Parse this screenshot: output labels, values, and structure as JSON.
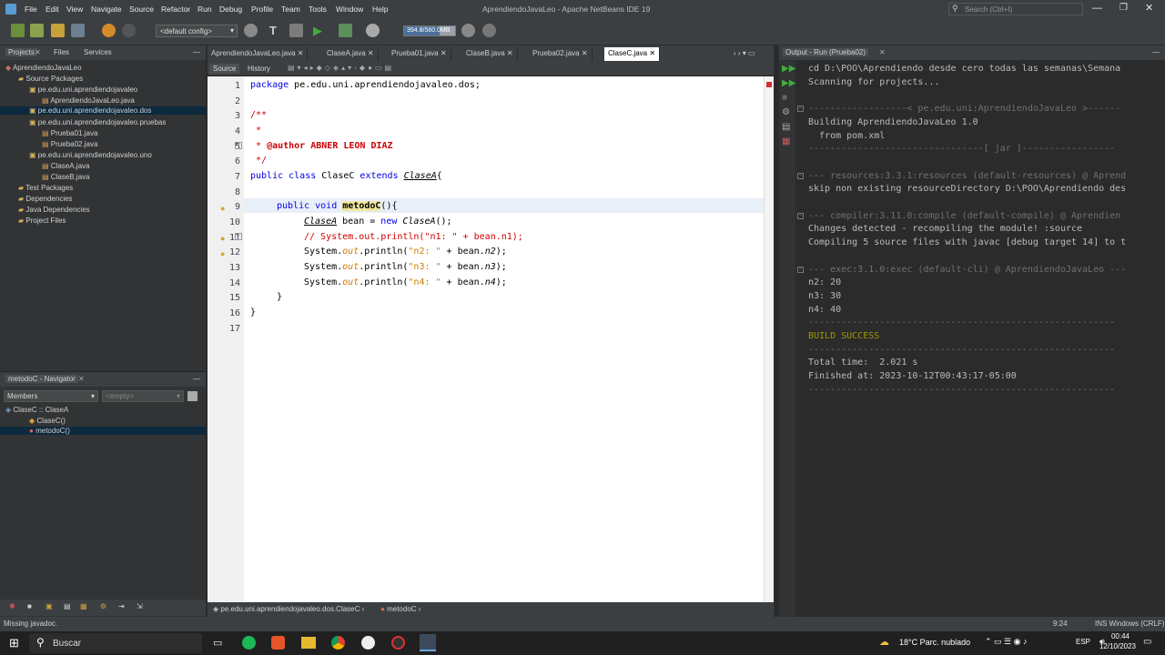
{
  "window": {
    "title": "AprendiendoJavaLeo - Apache NetBeans IDE 19",
    "search_placeholder": "Search (Ctrl+I)"
  },
  "menu": [
    "File",
    "Edit",
    "View",
    "Navigate",
    "Source",
    "Refactor",
    "Run",
    "Debug",
    "Profile",
    "Team",
    "Tools",
    "Window",
    "Help"
  ],
  "toolbar": {
    "config": "<default config>",
    "memory": "394.8/560.0MB"
  },
  "projects": {
    "tabs": [
      "Projects",
      "Files",
      "Services"
    ],
    "tree": [
      "AprendiendoJavaLeo",
      "Source Packages",
      "pe.edu.uni.aprendiendojavaleo",
      "AprendiendoJavaLeo.java",
      "pe.edu.uni.aprendiendojavaleo.dos",
      "pe.edu.uni.aprendiendojavaleo.pruebas",
      "Prueba01.java",
      "Prueba02.java",
      "pe.edu.uni.aprendiendojavaleo.uno",
      "ClaseA.java",
      "ClaseB.java",
      "Test Packages",
      "Dependencies",
      "Java Dependencies",
      "Project Files"
    ]
  },
  "navigator": {
    "title": "metodoC - Navigator",
    "filter": "Members",
    "empty": "<empty>",
    "items": [
      "ClaseC :: ClaseA",
      "ClaseC()",
      "metodoC()"
    ]
  },
  "editor": {
    "tabs": [
      "AprendiendoJavaLeo.java",
      "ClaseA.java",
      "Prueba01.java",
      "ClaseB.java",
      "Prueba02.java",
      "ClaseC.java"
    ],
    "source_tab": "Source",
    "history_tab": "History",
    "line_numbers": [
      "1",
      "2",
      "3",
      "4",
      "5",
      "6",
      "7",
      "8",
      "9",
      "10",
      "11",
      "12",
      "13",
      "14",
      "15",
      "16",
      "17"
    ],
    "code": {
      "l1a": "package",
      "l1b": " pe.edu.uni.aprendiendojavaleo.dos;",
      "l3": "/**",
      "l4": " *",
      "l5a": " * ",
      "l5b": "@author",
      "l5c": " ABNER LEON DIAZ",
      "l6": " */",
      "l7a": "public class",
      "l7b": " ClaseC ",
      "l7c": "extends",
      "l7d": "ClaseA",
      "l7e": "{",
      "l9a": "public void",
      "l9b": "metodoC",
      "l9c": "(){",
      "l10a": "ClaseA",
      "l10b": " bean = ",
      "l10c": "new",
      "l10d": "ClaseA",
      "l10e": "();",
      "l11": "// System.out.println(\"n1: \" + bean.n1);",
      "l12a": "System.",
      "l12b": "out",
      "l12c": ".println(",
      "l12d": "\"n2: \"",
      "l12e": " + bean.",
      "l12f": "n2",
      "l12g": ");",
      "l13a": "System.",
      "l13b": "out",
      "l13c": ".println(",
      "l13d": "\"n3: \"",
      "l13e": " + bean.",
      "l13f": "n3",
      "l13g": ");",
      "l14a": "System.",
      "l14b": "out",
      "l14c": ".println(",
      "l14d": "\"n4: \"",
      "l14e": " + bean.",
      "l14f": "n4",
      "l14g": ");",
      "l15": "}",
      "l16": "}"
    },
    "breadcrumb": [
      "pe.edu.uni.aprendiendojavaleo.dos.ClaseC",
      "metodoC"
    ]
  },
  "output": {
    "title": "Output - Run (Prueba02)",
    "lines": [
      "cd D:\\POO\\Aprendiendo desde cero todas las semanas\\Semana",
      "Scanning for projects...",
      "",
      "------------------< pe.edu.uni:AprendiendoJavaLeo >------",
      "Building AprendiendoJavaLeo 1.0",
      "  from pom.xml",
      "--------------------------------[ jar ]-----------------",
      "",
      "--- resources:3.3.1:resources (default-resources) @ Aprend",
      "skip non existing resourceDirectory D:\\POO\\Aprendiendo des",
      "",
      "--- compiler:3.11.0:compile (default-compile) @ Aprendien",
      "Changes detected - recompiling the module! :source",
      "Compiling 5 source files with javac [debug target 14] to t",
      "",
      "--- exec:3.1.0:exec (default-cli) @ AprendiendoJavaLeo ---",
      "n2: 20",
      "n3: 30",
      "n4: 40",
      "--------------------------------------------------------",
      "BUILD SUCCESS",
      "--------------------------------------------------------",
      "Total time:  2.021 s",
      "Finished at: 2023-10-12T00:43:17-05:00",
      "--------------------------------------------------------"
    ]
  },
  "status": {
    "message": "Missing javadoc.",
    "position": "9:24",
    "mode": "INS Windows (CRLF)"
  },
  "taskbar": {
    "search": "Buscar",
    "weather": "18°C  Parc. nublado",
    "lang": "ESP",
    "time": "00:44",
    "date": "12/10/2023"
  }
}
